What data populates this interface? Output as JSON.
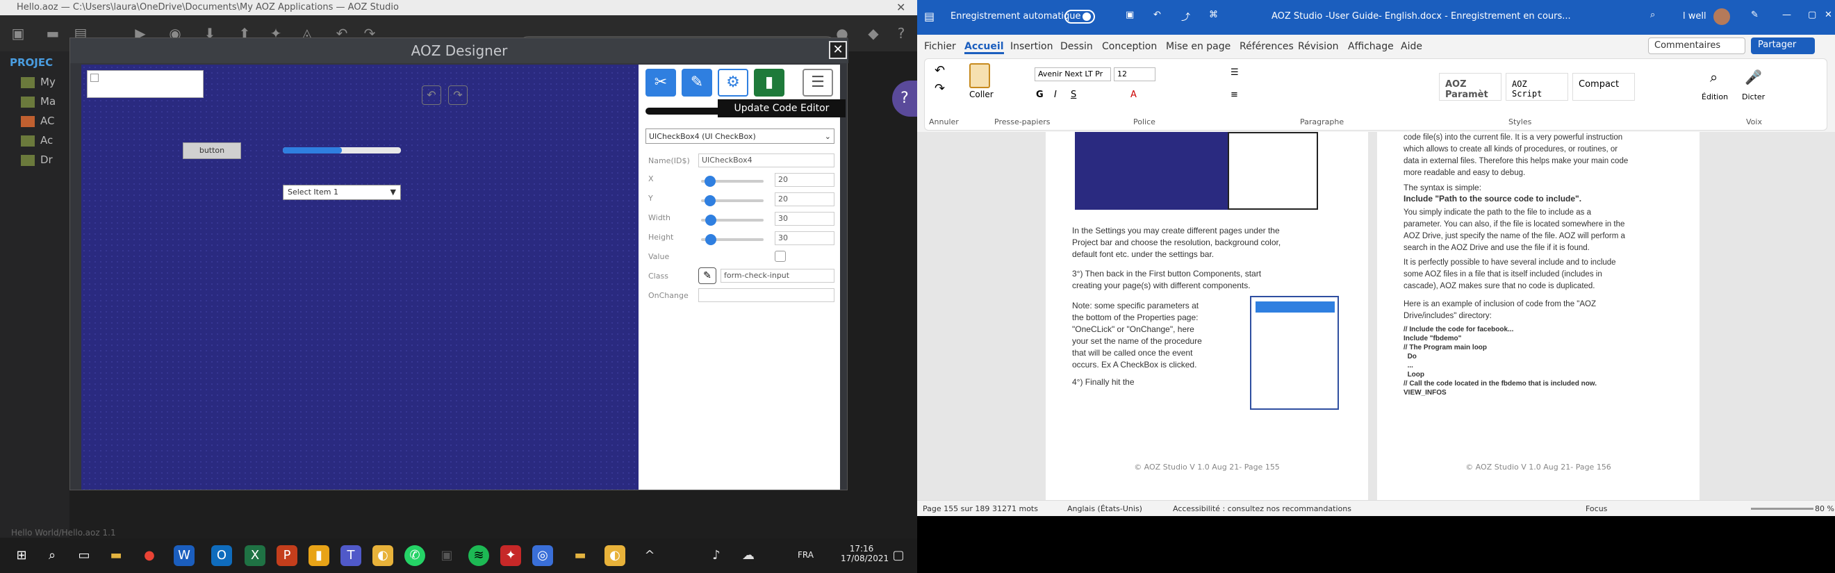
{
  "aoz": {
    "window_title": "Hello.aoz — C:\\Users\\laura\\OneDrive\\Documents\\My AOZ Applications — AOZ Studio",
    "sidebar_header": "PROJEC",
    "sidebar_items": [
      "My",
      "Ma",
      "AC",
      "Ac",
      "Dr"
    ],
    "status_left": "Hello World/Hello.aoz  1.1",
    "designer": {
      "title": "AOZ Designer",
      "tooltip": "Update Code Editor",
      "canvas_button": "button",
      "canvas_select": "Select Item 1",
      "progress": 0.5,
      "component_select": "UICheckBox4 (UI CheckBox)",
      "fields": [
        {
          "label": "Name(ID$)",
          "value": "UICheckBox4"
        },
        {
          "label": "X",
          "value": "20",
          "slider": 0.05
        },
        {
          "label": "Y",
          "value": "20",
          "slider": 0.05
        },
        {
          "label": "Width",
          "value": "30",
          "slider": 0.07
        },
        {
          "label": "Height",
          "value": "30",
          "slider": 0.07
        },
        {
          "label": "Value",
          "value": ""
        },
        {
          "label": "Class",
          "value": "form-check-input"
        },
        {
          "label": "OnChange",
          "value": ""
        }
      ]
    },
    "clock": {
      "time": "17:16",
      "date": "17/08/2021"
    },
    "lang": "FRA"
  },
  "word": {
    "autosave": "Enregistrement automatique",
    "title": "AOZ Studio -User Guide- English.docx  -  Enregistrement en cours...",
    "user": "l well",
    "menu": [
      "Fichier",
      "Accueil",
      "Insertion",
      "Dessin",
      "Conception",
      "Mise en page",
      "Références",
      "Révision",
      "Affichage",
      "Aide"
    ],
    "comments": "Commentaires",
    "share": "Partager",
    "ribbon": {
      "undo": "Annuler",
      "clipboard": "Presse-papiers",
      "paste": "Coller",
      "font": "Avenir Next LT Pr",
      "size": "12",
      "police": "Police",
      "paragraphe": "Paragraphe",
      "styles": [
        "AOZ Paramèt",
        "AOZ Script",
        "Compact"
      ],
      "styles_label": "Styles",
      "edition": "Édition",
      "dicter": "Dicter",
      "voix": "Voix"
    },
    "page_left": {
      "p1": "In the Settings you may create different pages under the\nProject bar and choose the resolution, background color,\ndefault font etc. under the settings bar.",
      "p2": "3°) Then back in the First button Components, start\ncreating your page(s) with different components.",
      "p3": "Note: some specific parameters at\nthe bottom of the Properties page:\n\"OneCLick\" or \"OnChange\", here\nyour set the name of the procedure\nthat will be called once the event\noccurs. Ex A CheckBox is clicked.",
      "p4": "4°) Finally hit the",
      "footer": "© AOZ Studio V 1.0 Aug 21- Page 155"
    },
    "page_right": {
      "p0": "code file(s) into the current file. It is a very powerful instruction\nwhich allows to create all kinds of procedures, or routines, or\ndata in external files. Therefore this helps make your main code\nmore readable and easy to debug.",
      "p1": "The syntax is simple:",
      "p1b": "Include \"Path to the source code to include\".",
      "p2": "You simply indicate the path to the file to include as a\nparameter. You can also, if the file is located somewhere in the\nAOZ Drive, just specify the name of the file. AOZ will perform a\nsearch in the AOZ Drive and use the file if it is found.",
      "p3": "It is perfectly possible to have several include and to include\nsome AOZ files in a file that is itself included (includes in\ncascade), AOZ makes sure that no code is duplicated.",
      "p4": "Here is an example of inclusion of code from the \"AOZ\nDrive/includes\" directory:",
      "code": "// Include the code for facebook...\nInclude \"fbdemo\"\n// The Program main loop\n  Do\n  ...\n  Loop\n// Call the code located in the fbdemo that is included now.\nVIEW_INFOS",
      "footer": "© AOZ Studio V 1.0 Aug 21- Page 156"
    },
    "status": {
      "page": "Page 155 sur 189",
      "words": "31271 mots",
      "lang": "Anglais (États-Unis)",
      "access": "Accessibilité : consultez nos recommandations",
      "focus": "Focus",
      "zoom": "80 %"
    }
  }
}
